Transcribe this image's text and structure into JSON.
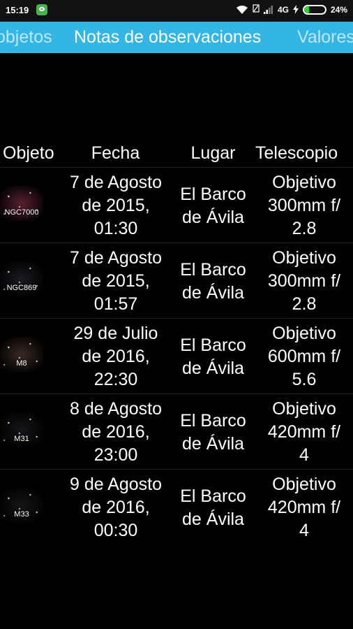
{
  "status": {
    "time": "15:19",
    "network": "4G",
    "battery_pct": "24%",
    "battery_level": 0.24,
    "icons": [
      "wechat-icon",
      "wifi-icon",
      "sim-no-signal-icon",
      "signal-icon",
      "charging-icon",
      "battery-icon"
    ],
    "battery_color": "#32cd32"
  },
  "tabs": {
    "left": "objetos",
    "active": "Notas de observaciones",
    "right": "Valores",
    "bar_color": "#33b5e5"
  },
  "table": {
    "headers": [
      "Objeto",
      "Fecha",
      "Lugar",
      "Telescopio"
    ],
    "rows": [
      {
        "object": "NGC7000",
        "fecha": [
          "7 de Agosto",
          "de 2015,",
          "01:30"
        ],
        "lugar": [
          "El Barco",
          "de Ávila"
        ],
        "telescopio": [
          "Objetivo",
          "300mm f/",
          "2.8"
        ],
        "thumb_color": "#5a2030"
      },
      {
        "object": "NGC869",
        "fecha": [
          "7 de Agosto",
          "de 2015,",
          "01:57"
        ],
        "lugar": [
          "El Barco",
          "de Ávila"
        ],
        "telescopio": [
          "Objetivo",
          "300mm f/",
          "2.8"
        ],
        "thumb_color": "#1a1a22"
      },
      {
        "object": "M8",
        "fecha": [
          "29 de Julio",
          "de 2016,",
          "22:30"
        ],
        "lugar": [
          "El Barco",
          "de Ávila"
        ],
        "telescopio": [
          "Objetivo",
          "600mm f/",
          "5.6"
        ],
        "thumb_color": "#3a2a22"
      },
      {
        "object": "M31",
        "fecha": [
          "8 de Agosto",
          "de 2016,",
          "23:00"
        ],
        "lugar": [
          "El Barco",
          "de Ávila"
        ],
        "telescopio": [
          "Objetivo",
          "420mm f/",
          "4"
        ],
        "thumb_color": "#15151a"
      },
      {
        "object": "M33",
        "fecha": [
          "9 de Agosto",
          "de 2016,",
          "00:30"
        ],
        "lugar": [
          "El Barco",
          "de Ávila"
        ],
        "telescopio": [
          "Objetivo",
          "420mm f/",
          "4"
        ],
        "thumb_color": "#151518"
      }
    ]
  }
}
